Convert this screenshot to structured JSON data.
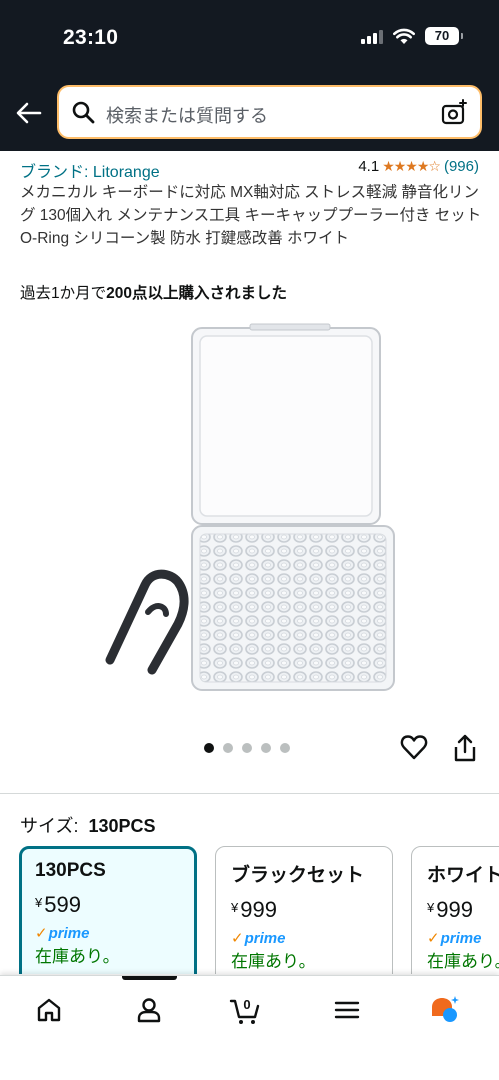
{
  "status": {
    "time": "23:10",
    "battery": "70"
  },
  "search": {
    "placeholder": "検索または質問する"
  },
  "product": {
    "brand": "ブランド: Litorange",
    "rating_value": "4.1",
    "rating_stars": 4.1,
    "rating_count": "(996)",
    "title": "メカニカル キーボードに対応 MX軸対応 ストレス軽減 静音化リング 130個入れ メンテナンス工具 キーキャッププーラー付き セット O-Ring シリコーン製 防水 打鍵感改善 ホワイト",
    "bought_prefix": "過去1か月で",
    "bought_bold": "200点以上購入されました"
  },
  "carousel": {
    "count": 5,
    "active": 0
  },
  "size": {
    "label": "サイズ:",
    "selected": "130PCS",
    "options": [
      {
        "name": "130PCS",
        "currency": "¥",
        "price": "599",
        "prime": "prime",
        "stock": "在庫あり。"
      },
      {
        "name": "ブラックセット",
        "currency": "¥",
        "price": "999",
        "prime": "prime",
        "stock": "在庫あり。"
      },
      {
        "name": "ホワイト",
        "currency": "¥",
        "price": "999",
        "prime": "prime",
        "stock": "在庫あり。"
      }
    ]
  },
  "cart": {
    "count": "0"
  },
  "colors": {
    "header_bg": "#131921",
    "link": "#007185",
    "star": "#de7921",
    "stock": "#007600",
    "prime": "#1a98ff",
    "selected_border": "#007185"
  }
}
